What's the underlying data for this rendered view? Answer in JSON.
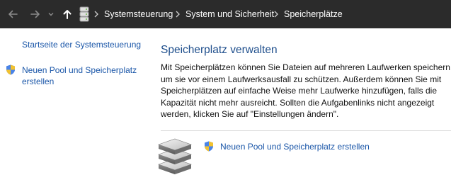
{
  "address_bar": {
    "back_icon": "arrow-left-icon",
    "forward_icon": "arrow-right-icon",
    "recent_icon": "chevron-down-icon",
    "up_icon": "arrow-up-icon",
    "location_icon": "storage-spaces-icon",
    "breadcrumbs": [
      "Systemsteuerung",
      "System und Sicherheit",
      "Speicherplätze"
    ]
  },
  "sidebar": {
    "home_link": "Startseite der Systemsteuerung",
    "new_pool_link_line1": "Neuen Pool und Speicherplatz",
    "new_pool_link_line2": "erstellen"
  },
  "main": {
    "title": "Speicherplatz verwalten",
    "description_lines": [
      "Mit Speicherplätzen können Sie Dateien auf mehreren Laufwerken speichern,",
      "um sie vor einem Laufwerksausfall zu schützen. Außerdem können Sie mit",
      "Speicherplätzen auf einfache Weise mehr Laufwerke hinzufügen, falls die",
      "Kapazität nicht mehr ausreicht. Sollten die Aufgabenlinks nicht angezeigt",
      "werden, klicken Sie auf \"Einstellungen ändern\"."
    ],
    "task_link": "Neuen Pool und Speicherplatz erstellen"
  },
  "colors": {
    "titlebar_bg": "#2b2b2b",
    "link": "#1a56a8",
    "heading": "#1e4e8c"
  }
}
